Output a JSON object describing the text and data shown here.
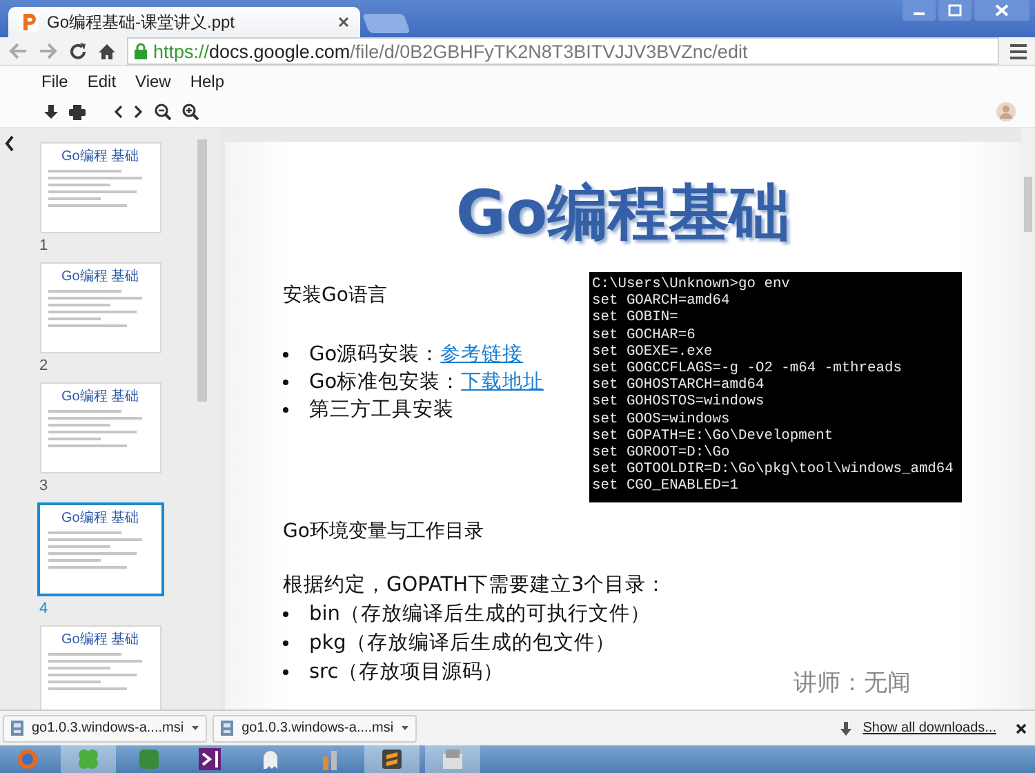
{
  "browser": {
    "tab": {
      "title": "Go编程基础-课堂讲义.ppt",
      "selected": true
    },
    "url": {
      "scheme": "https://",
      "host": "docs.google.com",
      "path": "/file/d/0B2GBHFyTK2N8T3BITVJJV3BVZnc/edit"
    }
  },
  "menu": [
    "File",
    "Edit",
    "View",
    "Help"
  ],
  "thumbnails": [
    {
      "number": "1",
      "title": "Go编程 基础",
      "selected": false
    },
    {
      "number": "2",
      "title": "Go编程 基础",
      "selected": false
    },
    {
      "number": "3",
      "title": "Go编程 基础",
      "selected": false
    },
    {
      "number": "4",
      "title": "Go编程 基础",
      "selected": true
    },
    {
      "title": "Go编程 基础",
      "selected": false
    }
  ],
  "slide": {
    "title": "Go编程基础",
    "section_1": {
      "heading": "安装Go语言",
      "bullets": [
        {
          "text": "Go源码安装：",
          "link": "参考链接"
        },
        {
          "text": "Go标准包安装：",
          "link": "下载地址"
        },
        {
          "text": "第三方工具安装"
        }
      ]
    },
    "terminal": [
      "C:\\Users\\Unknown>go env",
      "set GOARCH=amd64",
      "set GOBIN=",
      "set GOCHAR=6",
      "set GOEXE=.exe",
      "set GOGCCFLAGS=-g -O2 -m64 -mthreads",
      "set GOHOSTARCH=amd64",
      "set GOHOSTOS=windows",
      "set GOOS=windows",
      "set GOPATH=E:\\Go\\Development",
      "set GOROOT=D:\\Go",
      "set GOTOOLDIR=D:\\Go\\pkg\\tool\\windows_amd64",
      "set CGO_ENABLED=1"
    ],
    "section_2": {
      "heading": "Go环境变量与工作目录",
      "paragraph": "根据约定，GOPATH下需要建立3个目录：",
      "bullets": [
        "bin（存放编译后生成的可执行文件）",
        "pkg（存放编译后生成的包文件）",
        "src（存放项目源码）"
      ]
    },
    "lecturer": "讲师：无闻"
  },
  "downloads": {
    "items": [
      "go1.0.3.windows-a....msi",
      "go1.0.3.windows-a....msi"
    ],
    "show_all": "Show all downloads..."
  }
}
